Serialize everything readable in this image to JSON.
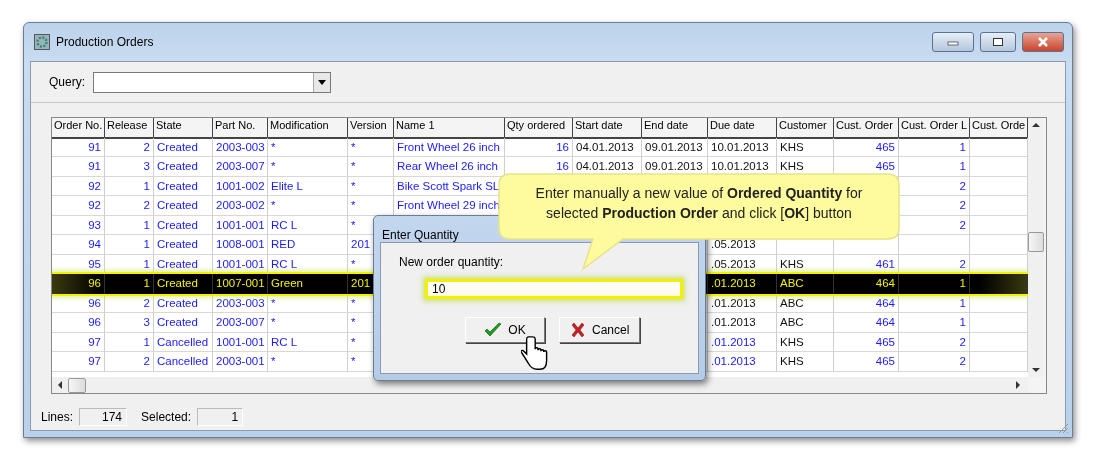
{
  "window": {
    "title": "Production Orders"
  },
  "query": {
    "label": "Query:"
  },
  "table": {
    "columns": [
      "Order No.",
      "Release",
      "State",
      "Part No.",
      "Modification",
      "Version",
      "Name 1",
      "Qty ordered",
      "Start date",
      "End date",
      "Due date",
      "Customer",
      "Cust. Order",
      "Cust. Order L",
      "Cust. Orde"
    ],
    "rows": [
      {
        "selected": false,
        "kind": "active",
        "order_no": "91",
        "release": "2",
        "state": "Created",
        "part_no": "2003-003",
        "modification": "*",
        "version": "*",
        "name_1": "Front Wheel 26 inch",
        "qty_ordered": "16",
        "start_date": "04.01.2013",
        "end_date": "09.01.2013",
        "due_date": "10.01.2013",
        "customer": "KHS",
        "cust_order": "465",
        "cust_order_l": "1"
      },
      {
        "selected": false,
        "kind": "active",
        "order_no": "91",
        "release": "3",
        "state": "Created",
        "part_no": "2003-007",
        "modification": "*",
        "version": "*",
        "name_1": "Rear Wheel 26 inch",
        "qty_ordered": "16",
        "start_date": "04.01.2013",
        "end_date": "09.01.2013",
        "due_date": "10.01.2013",
        "customer": "KHS",
        "cust_order": "465",
        "cust_order_l": "1"
      },
      {
        "selected": false,
        "kind": "active",
        "order_no": "92",
        "release": "1",
        "state": "Created",
        "part_no": "1001-002",
        "modification": "Elite L",
        "version": "*",
        "name_1": "Bike Scott Spark SL",
        "cust_order_l": "2"
      },
      {
        "selected": false,
        "kind": "active",
        "order_no": "92",
        "release": "2",
        "state": "Created",
        "part_no": "2003-002",
        "modification": "*",
        "version": "*",
        "name_1": "Front Wheel 29 inch",
        "cust_order_l": "2"
      },
      {
        "selected": false,
        "kind": "active",
        "order_no": "93",
        "release": "1",
        "state": "Created",
        "part_no": "1001-001",
        "modification": "RC L",
        "version": "*",
        "cust_order_l": "2"
      },
      {
        "selected": false,
        "kind": "active",
        "order_no": "94",
        "release": "1",
        "state": "Created",
        "part_no": "1008-001",
        "modification": "RED",
        "version": "201",
        "due_date": ".05.2013"
      },
      {
        "selected": false,
        "kind": "active",
        "order_no": "95",
        "release": "1",
        "state": "Created",
        "part_no": "1001-001",
        "modification": "RC L",
        "version": "*",
        "due_date": ".05.2013",
        "customer": "KHS",
        "cust_order": "461",
        "cust_order_l": "2"
      },
      {
        "selected": true,
        "kind": "active",
        "order_no": "96",
        "release": "1",
        "state": "Created",
        "part_no": "1007-001",
        "modification": "Green",
        "version": "201",
        "due_date": ".01.2013",
        "customer": "ABC",
        "cust_order": "464",
        "cust_order_l": "1"
      },
      {
        "selected": false,
        "kind": "active",
        "order_no": "96",
        "release": "2",
        "state": "Created",
        "part_no": "2003-003",
        "modification": "*",
        "version": "*",
        "due_date": ".01.2013",
        "customer": "ABC",
        "cust_order": "464",
        "cust_order_l": "1"
      },
      {
        "selected": false,
        "kind": "active",
        "order_no": "96",
        "release": "3",
        "state": "Created",
        "part_no": "2003-007",
        "modification": "*",
        "version": "*",
        "due_date": ".01.2013",
        "customer": "ABC",
        "cust_order": "464",
        "cust_order_l": "1"
      },
      {
        "selected": false,
        "kind": "cancelled",
        "order_no": "97",
        "release": "1",
        "state": "Cancelled",
        "part_no": "1001-001",
        "modification": "RC L",
        "version": "*",
        "due_date": ".01.2013",
        "customer": "KHS",
        "cust_order": "465",
        "cust_order_l": "2"
      },
      {
        "selected": false,
        "kind": "cancelled",
        "order_no": "97",
        "release": "2",
        "state": "Cancelled",
        "part_no": "2003-001",
        "modification": "*",
        "version": "*",
        "due_date": ".01.2013",
        "customer": "KHS",
        "cust_order": "465",
        "cust_order_l": "2"
      }
    ]
  },
  "status_bar": {
    "lines_label": "Lines:",
    "lines": "174",
    "selected_label": "Selected:",
    "selected": "1"
  },
  "dialog": {
    "title": "Enter Quantity",
    "label": "New order quantity:",
    "value": "10",
    "buttons": [
      "OK",
      "Cancel"
    ]
  },
  "callout": {
    "text": "Enter manually a new value of **Ordered Quantity** for selected **Production  Order** and click [**OK**] button"
  }
}
